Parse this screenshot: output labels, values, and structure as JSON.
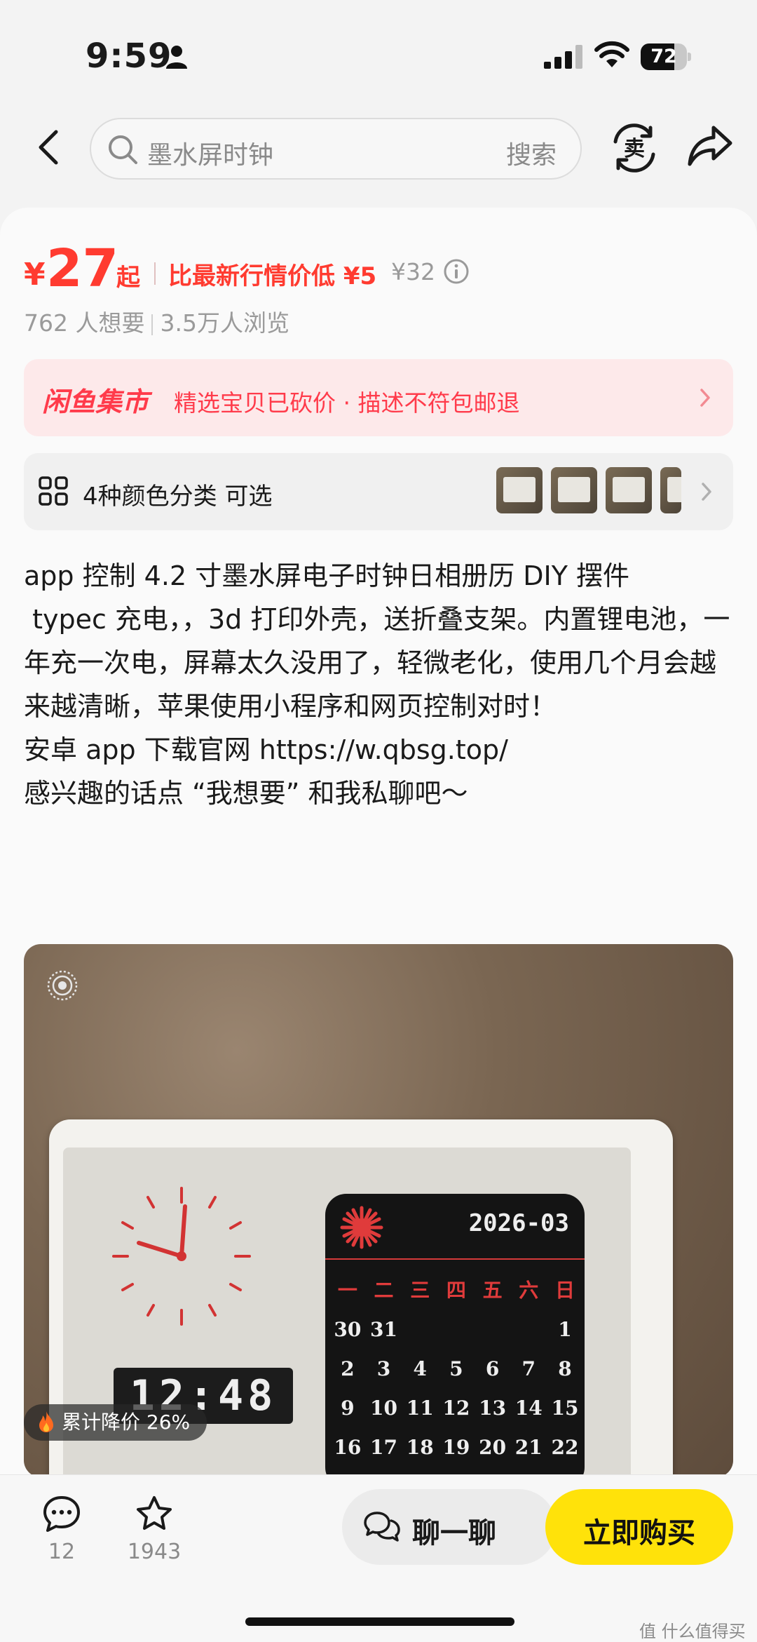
{
  "status_bar": {
    "time": "9:59",
    "battery": "72",
    "battery_level": 0.72
  },
  "search": {
    "query": "墨水屏时钟",
    "button_label": "搜索"
  },
  "price": {
    "currency": "¥",
    "amount": "27",
    "suffix": "起",
    "compare_text": "比最新行情价低 ¥5",
    "original": "¥32"
  },
  "stats": {
    "wants": "762 人想要",
    "views": "3.5万人浏览"
  },
  "banner": {
    "logo": "闲鱼集市",
    "text": "精选宝贝已砍价 · 描述不符包邮退"
  },
  "sku": {
    "text": "4种颜色分类  可选"
  },
  "description": "app 控制 4.2 寸墨水屏电子时钟日相册历 DIY 摆件\n typec 充电，，3d 打印外壳，送折叠支架。内置锂电池，一年充一次电，屏幕太久没用了，轻微老化，使用几个月会越来越清晰，苹果使用小程序和网页控制对时！\n安卓 app 下载官网 https://w.qbsg.top/\n感兴趣的话点 “我想要” 和我私聊吧～",
  "photo": {
    "digital_time": "12:48",
    "calendar_month": "2026-03",
    "weekdays": [
      "一",
      "二",
      "三",
      "四",
      "五",
      "六",
      "日"
    ],
    "weeks": [
      [
        "30",
        "31",
        "",
        "",
        "",
        "",
        "1"
      ],
      [
        "2",
        "3",
        "4",
        "5",
        "6",
        "7",
        "8"
      ],
      [
        "9",
        "10",
        "11",
        "12",
        "13",
        "14",
        "15"
      ],
      [
        "16",
        "17",
        "18",
        "19",
        "20",
        "21",
        "22"
      ]
    ]
  },
  "badge": {
    "text": "累计降价 26%"
  },
  "bottom_bar": {
    "comments": "12",
    "favorites": "1943",
    "chat_label": "聊一聊",
    "buy_label": "立即购买"
  },
  "watermark": "值 什么值得买"
}
